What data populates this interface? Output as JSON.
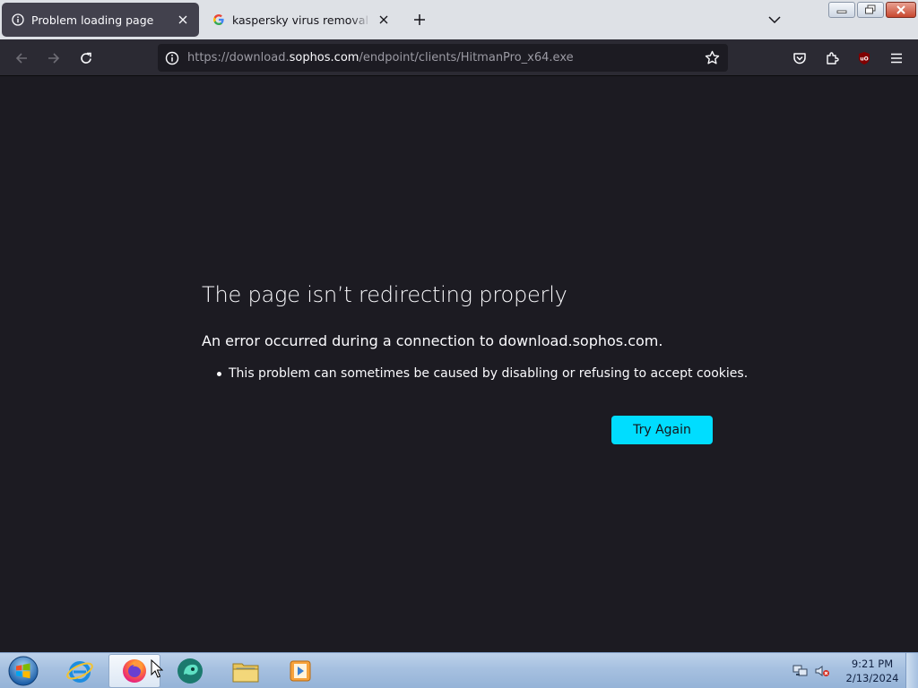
{
  "tabs": [
    {
      "label": "Problem loading page",
      "active": true,
      "icon": "info-icon"
    },
    {
      "label": "kaspersky virus removal - Goog",
      "active": false,
      "icon": "google-icon"
    }
  ],
  "navbar": {
    "url_prefix": "https://download.",
    "url_domain": "sophos.com",
    "url_suffix": "/endpoint/clients/HitmanPro_x64.exe"
  },
  "error": {
    "title": "The page isn’t redirecting properly",
    "description": "An error occurred during a connection to download.sophos.com.",
    "reasons": [
      "This problem can sometimes be caused by disabling or refusing to accept cookies."
    ],
    "button_label": "Try Again"
  },
  "taskbar": {
    "apps": [
      "start-orb",
      "internet-explorer",
      "firefox",
      "browser-app",
      "file-explorer",
      "media-player"
    ],
    "time": "9:21 PM",
    "date": "2/13/2024"
  },
  "colors": {
    "accent": "#00ddff",
    "page_background": "#1c1b22",
    "toolbar": "#2b2a33"
  }
}
